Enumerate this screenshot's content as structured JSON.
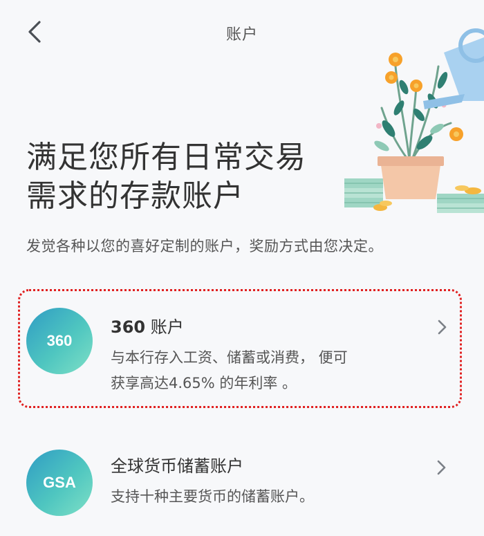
{
  "header": {
    "title": "账户"
  },
  "hero": {
    "heading_line1": "满足您所有日常交易",
    "heading_line2": "需求的存款账户",
    "subtitle": "发觉各种以您的喜好定制的账户，奖励方式由您决定。"
  },
  "accounts": [
    {
      "badge": "360",
      "title_number": "360",
      "title_text": " 账户",
      "desc_line1": "与本行存入工资、储蓄或消费， 便可",
      "desc_line2": "获享高达4.65% 的年利率 。",
      "highlighted": true
    },
    {
      "badge": "GSA",
      "title_text": "全球货币储蓄账户",
      "desc_line1": "支持十种主要货币的储蓄账户。",
      "highlighted": false
    }
  ],
  "icons": {
    "back": "chevron-left-icon",
    "chevron": "chevron-right-icon",
    "illustration": "watering-can-plant-illustration"
  },
  "colors": {
    "badge_gradient": [
      "#2f9cc4",
      "#7fe0c6"
    ],
    "highlight_border": "#e02020",
    "background": "#f7f8fa"
  }
}
